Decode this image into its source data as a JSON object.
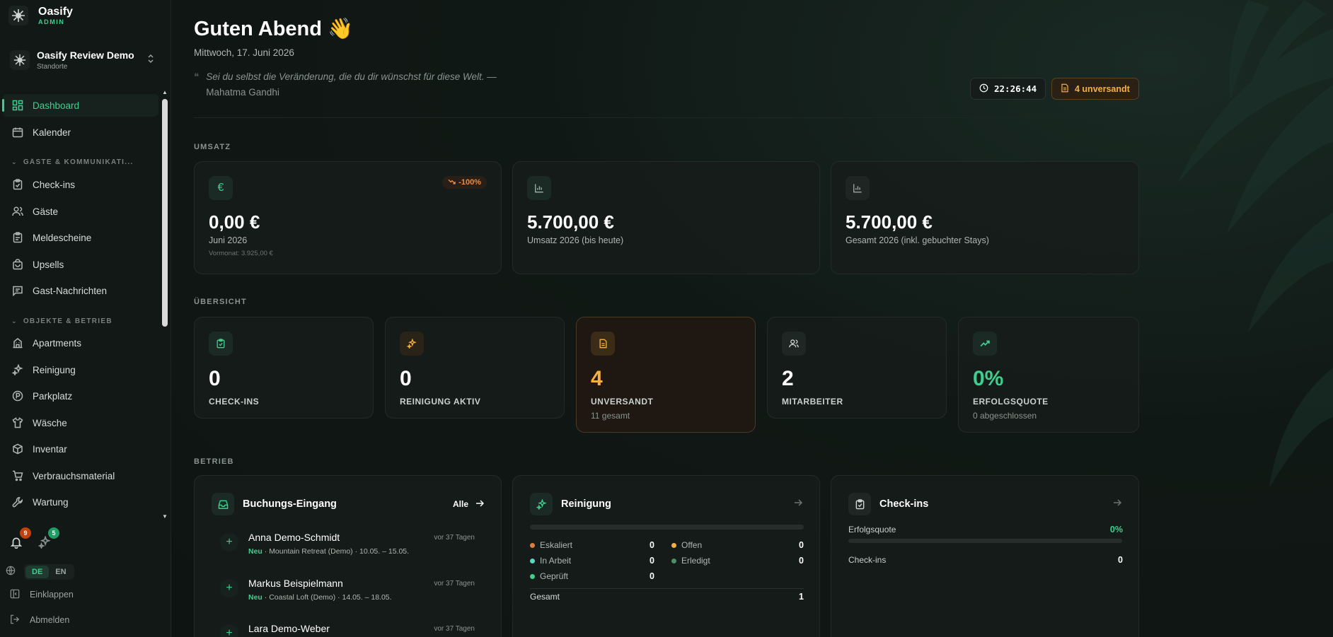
{
  "brand": {
    "name": "Oasify",
    "sub": "ADMIN"
  },
  "org": {
    "name": "Oasify Review Demo",
    "sub": "Standorte"
  },
  "nav": {
    "dashboard": "Dashboard",
    "kalender": "Kalender",
    "section_guests": "GÄSTE & KOMMUNIKATI...",
    "checkins": "Check-ins",
    "gaeste": "Gäste",
    "meldescheine": "Meldescheine",
    "upsells": "Upsells",
    "nachrichten": "Gast-Nachrichten",
    "section_objects": "OBJEKTE & BETRIEB",
    "apartments": "Apartments",
    "reinigung": "Reinigung",
    "parkplatz": "Parkplatz",
    "waesche": "Wäsche",
    "inventar": "Inventar",
    "verbrauch": "Verbrauchsmaterial",
    "wartung": "Wartung"
  },
  "footer": {
    "notifications_count": "9",
    "tasks_count": "5",
    "lang_de": "DE",
    "lang_en": "EN",
    "collapse": "Einklappen",
    "logout": "Abmelden"
  },
  "header": {
    "greeting": "Guten Abend 👋",
    "date": "Mittwoch, 17. Juni 2026",
    "quote_text": "Sei du selbst die Veränderung, die du dir wünschst für diese Welt. —",
    "quote_author": "Mahatma Gandhi",
    "clock": "22:26:44",
    "unsent": "4 unversandt"
  },
  "sections": {
    "umsatz": "UMSATZ",
    "uebersicht": "ÜBERSICHT",
    "betrieb": "BETRIEB"
  },
  "revenue": [
    {
      "value": "0,00 €",
      "label": "Juni 2026",
      "sub": "Vormonat: 3.925,00 €",
      "trend": "-100%"
    },
    {
      "value": "5.700,00 €",
      "label": "Umsatz 2026 (bis heute)"
    },
    {
      "value": "5.700,00 €",
      "label": "Gesamt 2026 (inkl. gebuchter Stays)"
    }
  ],
  "overview": [
    {
      "value": "0",
      "label": "CHECK-INS",
      "sub": ""
    },
    {
      "value": "0",
      "label": "REINIGUNG AKTIV",
      "sub": ""
    },
    {
      "value": "4",
      "label": "UNVERSANDT",
      "sub": "11 gesamt"
    },
    {
      "value": "2",
      "label": "MITARBEITER",
      "sub": ""
    },
    {
      "value": "0%",
      "label": "ERFOLGSQUOTE",
      "sub": "0 abgeschlossen"
    }
  ],
  "bookings": {
    "title": "Buchungs-Eingang",
    "link": "Alle",
    "items": [
      {
        "name": "Anna Demo-Schmidt",
        "when": "vor 37 Tagen",
        "tag": "Neu",
        "apartment": "Mountain Retreat (Demo)",
        "dates": "10.05. – 15.05."
      },
      {
        "name": "Markus Beispielmann",
        "when": "vor 37 Tagen",
        "tag": "Neu",
        "apartment": "Coastal Loft (Demo)",
        "dates": "14.05. – 18.05."
      },
      {
        "name": "Lara Demo-Weber",
        "when": "vor 37 Tagen",
        "tag": "",
        "apartment": "",
        "dates": ""
      }
    ]
  },
  "cleaning": {
    "title": "Reinigung",
    "progress": 0,
    "eskaliert_label": "Eskaliert",
    "eskaliert": "0",
    "offen_label": "Offen",
    "offen": "0",
    "inarbeit_label": "In Arbeit",
    "inarbeit": "0",
    "erledigt_label": "Erledigt",
    "erledigt": "0",
    "geprueft_label": "Geprüft",
    "geprueft": "0",
    "gesamt_label": "Gesamt",
    "gesamt": "1",
    "colors": {
      "eskaliert": "#e07b39",
      "offen": "#f5b042",
      "inarbeit": "#5fd3c4",
      "erledigt": "#4d8f6a",
      "geprueft": "#3ecf8e"
    }
  },
  "checkins_panel": {
    "title": "Check-ins",
    "quote_label": "Erfolgsquote",
    "quote_value": "0%",
    "progress": 0,
    "count_label": "Check-ins",
    "count_value": "0"
  },
  "colors": {
    "accent": "#3ecf8e",
    "warning": "#f5b042",
    "trend_down": "#f08a3c"
  }
}
